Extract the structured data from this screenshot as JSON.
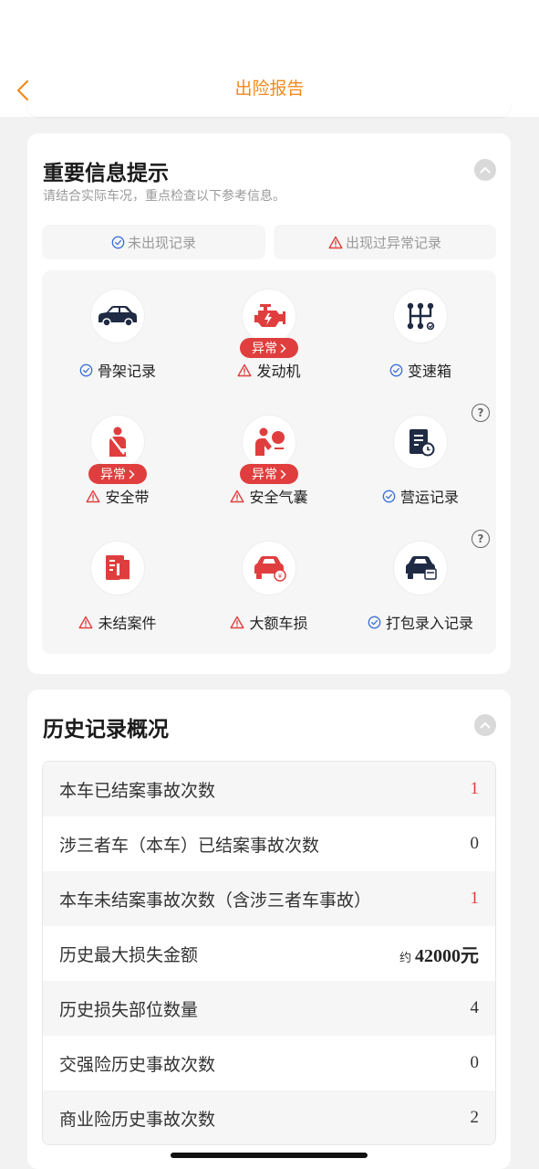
{
  "header": {
    "title": "出险报告"
  },
  "important": {
    "title": "重要信息提示",
    "subtitle": "请结合实际车况，重点检查以下参考信息。",
    "legend_ok": "未出现记录",
    "legend_warn": "出现过异常记录",
    "badge_text": "异常",
    "help_mark": "?",
    "items": [
      {
        "label": "骨架记录",
        "status": "ok",
        "icon": "car-frame-icon"
      },
      {
        "label": "发动机",
        "status": "warn",
        "icon": "engine-icon",
        "badge": true
      },
      {
        "label": "变速箱",
        "status": "ok",
        "icon": "gearbox-icon"
      },
      {
        "label": "安全带",
        "status": "warn",
        "icon": "seatbelt-icon",
        "badge": true
      },
      {
        "label": "安全气囊",
        "status": "warn",
        "icon": "airbag-icon",
        "badge": true
      },
      {
        "label": "营运记录",
        "status": "ok",
        "icon": "operation-record-icon",
        "help": true
      },
      {
        "label": "未结案件",
        "status": "warn",
        "icon": "open-case-icon"
      },
      {
        "label": "大额车损",
        "status": "warn",
        "icon": "major-damage-icon"
      },
      {
        "label": "打包录入记录",
        "status": "ok",
        "icon": "bundle-entry-icon",
        "help": true
      }
    ]
  },
  "history": {
    "title": "历史记录概况",
    "rows": [
      {
        "label": "本车已结案事故次数",
        "value": "1",
        "red": true
      },
      {
        "label": "涉三者车（本车）已结案事故次数",
        "value": "0"
      },
      {
        "label": "本车未结案事故次数（含涉三者车事故）",
        "value": "1",
        "red": true
      },
      {
        "label": "历史最大损失金额",
        "prefix": "约",
        "value": "42000元",
        "money": true
      },
      {
        "label": "历史损失部位数量",
        "value": "4"
      },
      {
        "label": "交强险历史事故次数",
        "value": "0"
      },
      {
        "label": "商业险历史事故次数",
        "value": "2"
      }
    ]
  },
  "colors": {
    "accent": "#f08a1c",
    "warn": "#e03e3e",
    "ok": "#3a6fd8",
    "icon_dark": "#1f2a44"
  }
}
